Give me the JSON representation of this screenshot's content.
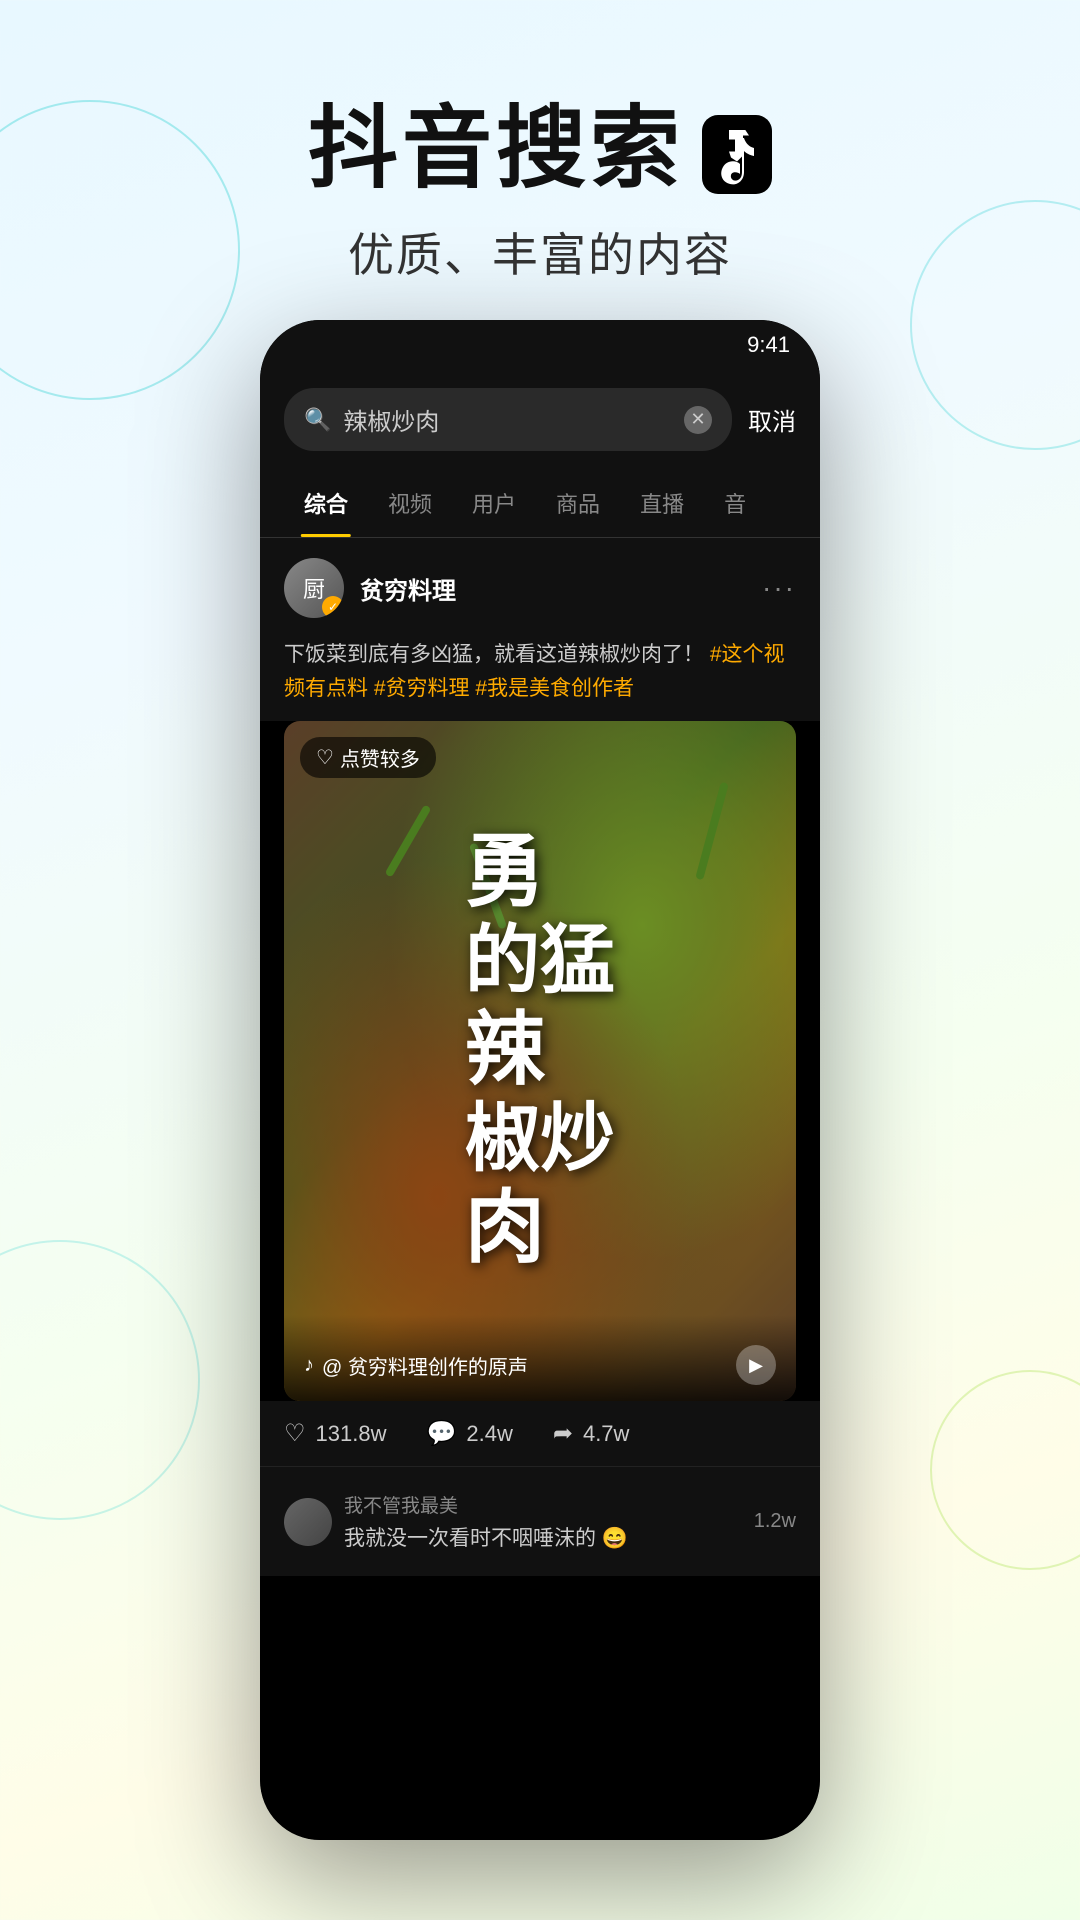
{
  "header": {
    "main_title": "抖音搜索",
    "sub_title": "优质、丰富的内容"
  },
  "phone": {
    "search_bar": {
      "query": "辣椒炒肉",
      "cancel_label": "取消"
    },
    "tabs": [
      {
        "label": "综合",
        "active": true
      },
      {
        "label": "视频",
        "active": false
      },
      {
        "label": "用户",
        "active": false
      },
      {
        "label": "商品",
        "active": false
      },
      {
        "label": "直播",
        "active": false
      },
      {
        "label": "音",
        "active": false
      }
    ],
    "card": {
      "user_name": "贫穷料理",
      "description": "下饭菜到底有多凶猛，就看这道辣椒炒肉了！",
      "hashtags": "#这个视频有点料 #贫穷料理 #我是美食创作者",
      "likes_badge": "点赞较多",
      "video_title": "勇猛辣椒炒肉",
      "video_text_line1": "勇",
      "video_text_line2": "的猛",
      "video_text_line3": "辣",
      "video_text_line4": "椒炒",
      "video_text_line5": "肉",
      "sound_label": "@ 贫穷料理创作的原声",
      "stats": {
        "likes": "131.8w",
        "comments": "2.4w",
        "shares": "4.7w"
      }
    },
    "comments": [
      {
        "user": "我不管我最美",
        "text": "我就没一次看时不咽唾沫的 😄",
        "count": "1.2w"
      }
    ]
  }
}
